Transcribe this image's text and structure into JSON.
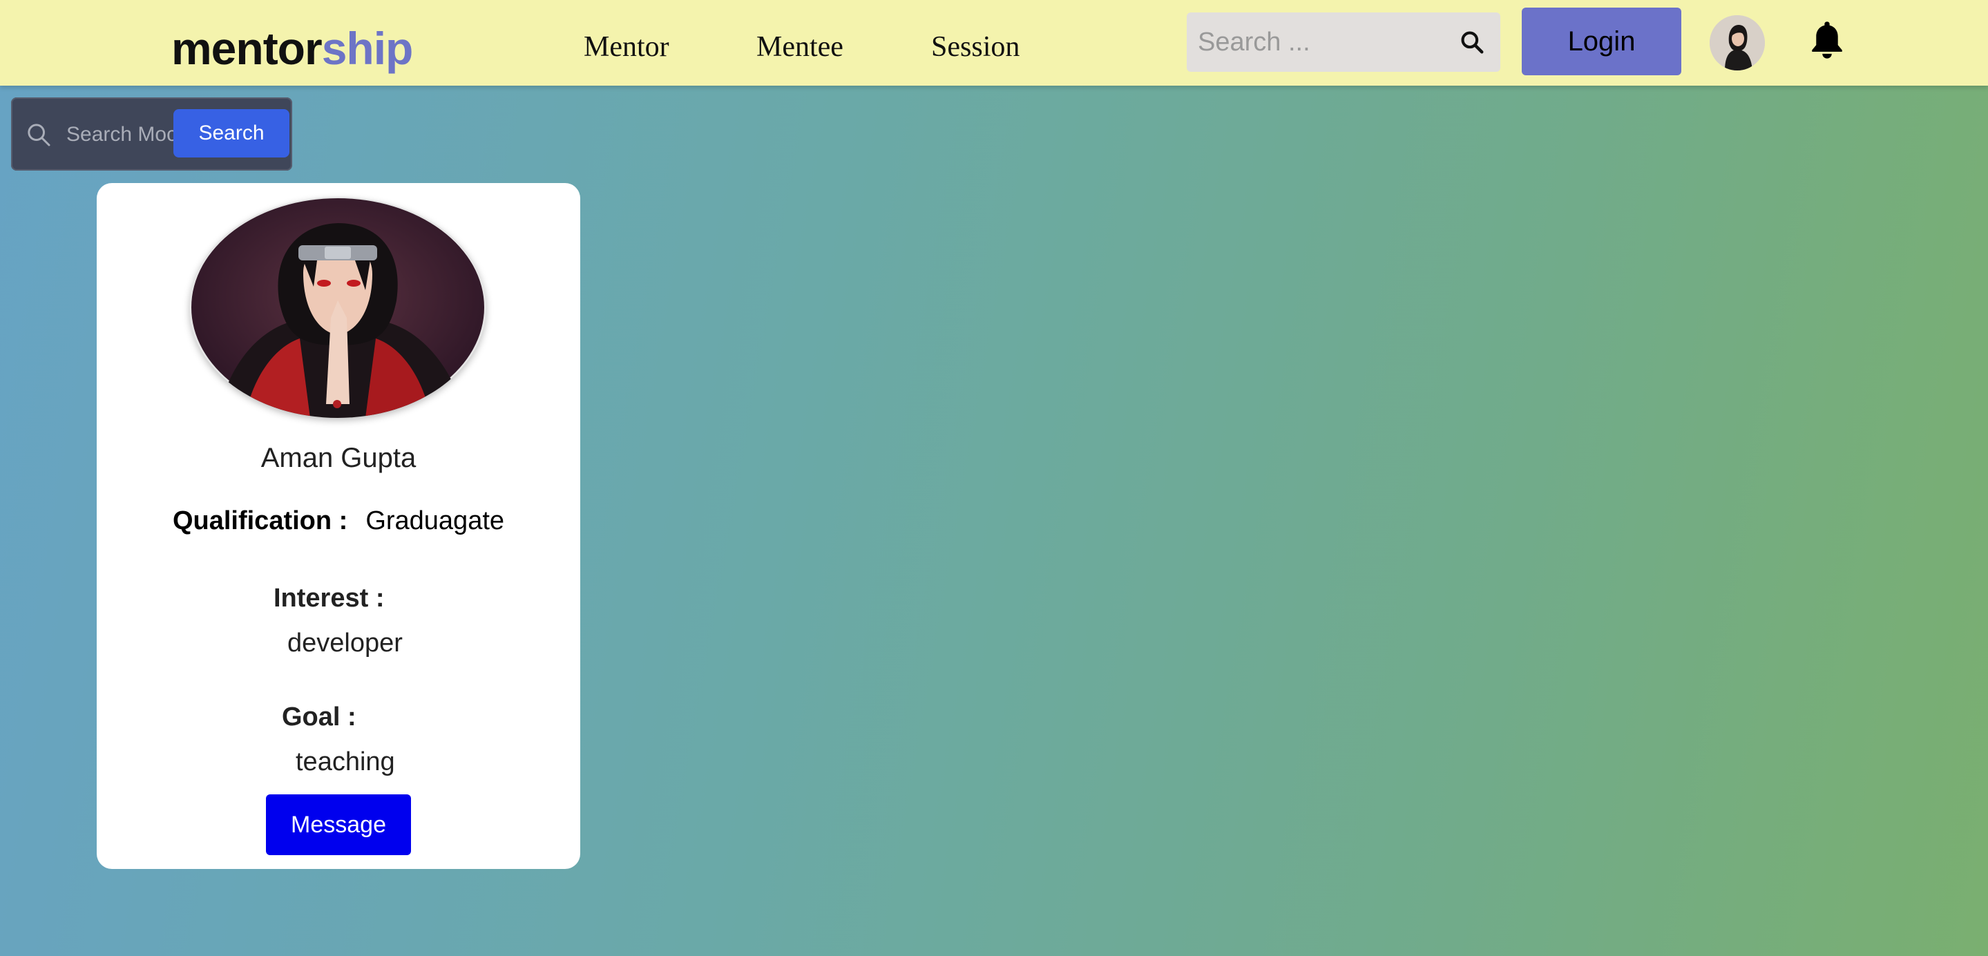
{
  "header": {
    "brand_part1": "mentor",
    "brand_part2": "ship",
    "nav": {
      "mentor": "Mentor",
      "mentee": "Mentee",
      "session": "Session"
    },
    "search_placeholder": "Search ...",
    "search_icon": "search-icon",
    "login_label": "Login",
    "avatar_icon": "user-avatar",
    "bell_icon": "bell-icon"
  },
  "mock_search": {
    "placeholder": "Search Mock",
    "button_label": "Search",
    "icon": "magnifier-icon"
  },
  "profile_card": {
    "name": "Aman Gupta",
    "qualification_label": "Qualification :",
    "qualification_value": "Graduagate",
    "interest_label": "Interest :",
    "interest_value": "developer",
    "goal_label": "Goal :",
    "goal_value": "teaching",
    "message_label": "Message"
  },
  "colors": {
    "header_bg": "#f4f3ad",
    "brand_accent": "#6d74c6",
    "login_bg": "#6b72c9",
    "mock_search_bg": "#3f4659",
    "search_button_bg": "#3761e4",
    "message_button_bg": "#0000ee"
  }
}
